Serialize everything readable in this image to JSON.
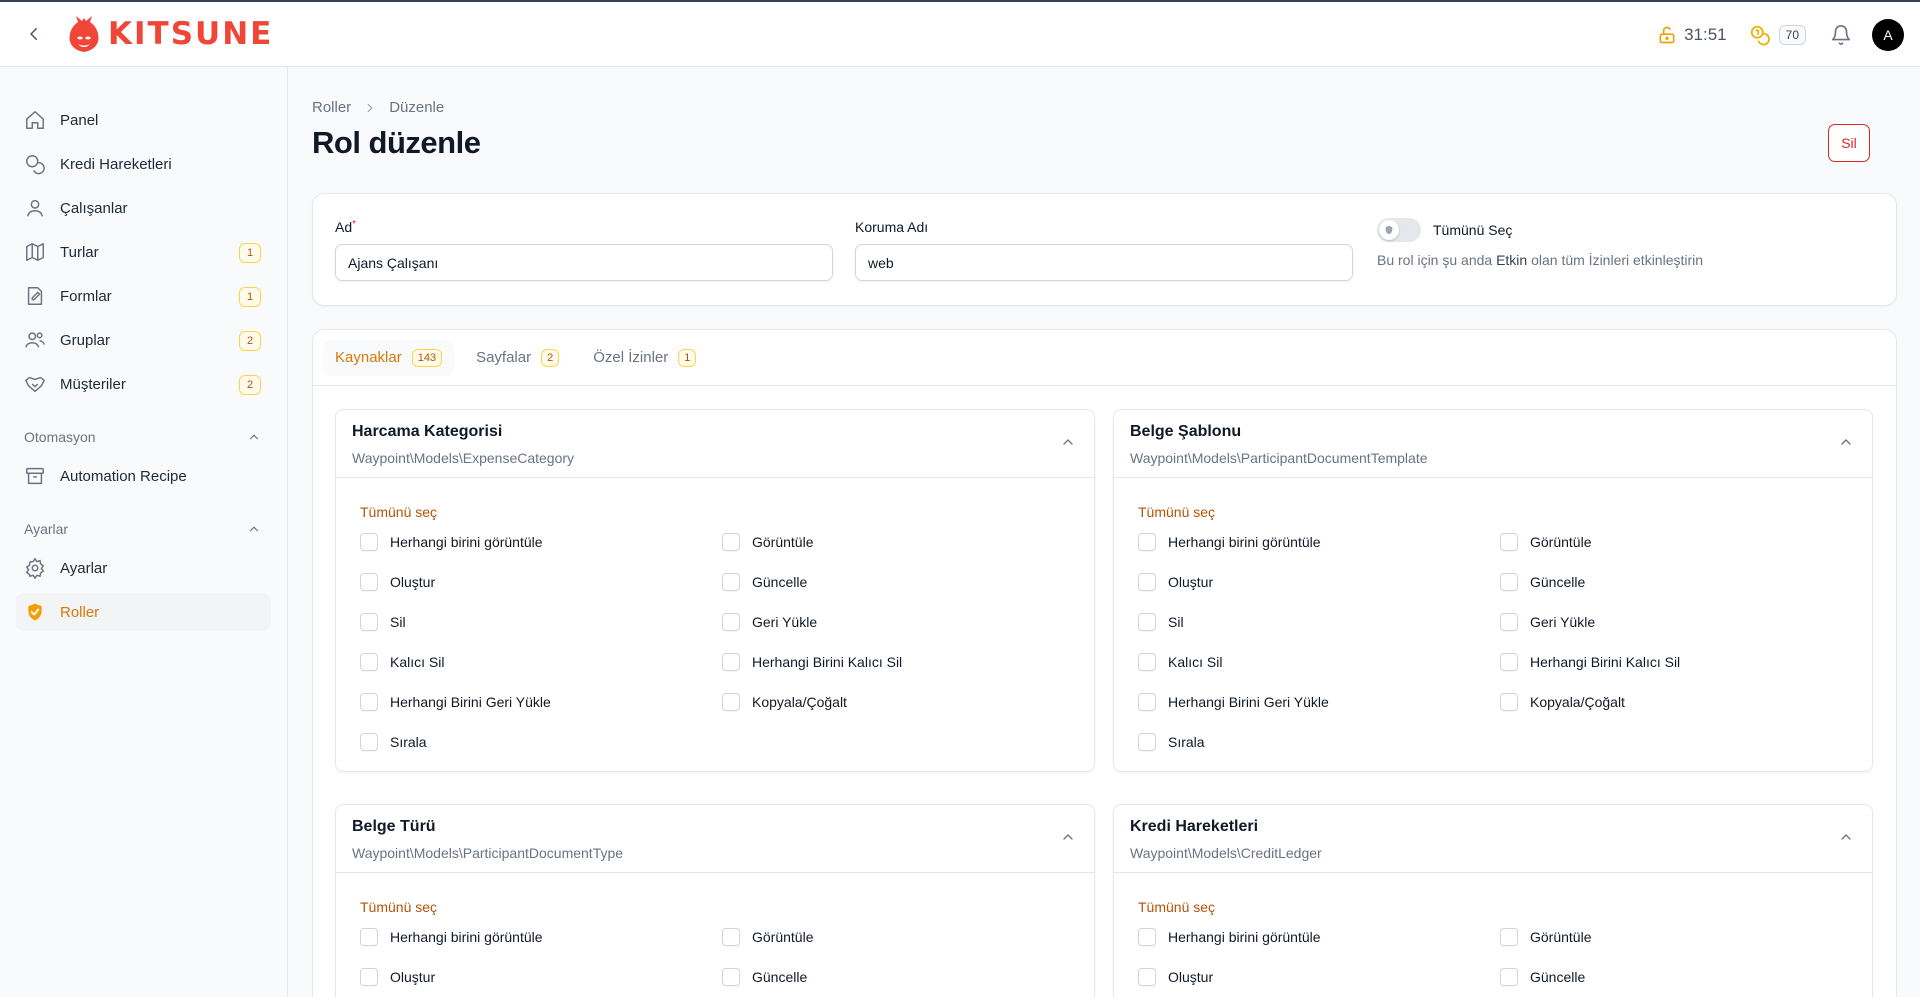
{
  "brand": {
    "name": "KITSUNE",
    "color": "#ef4637"
  },
  "topbar": {
    "timer": "31:51",
    "credits": "70",
    "avatar_initial": "A"
  },
  "sidebar": {
    "items": [
      {
        "label": "Panel",
        "icon": "home-icon"
      },
      {
        "label": "Kredi Hareketleri",
        "icon": "coins-icon"
      },
      {
        "label": "Çalışanlar",
        "icon": "user-icon"
      },
      {
        "label": "Turlar",
        "icon": "map-icon",
        "badge": "1"
      },
      {
        "label": "Formlar",
        "icon": "form-icon",
        "badge": "1"
      },
      {
        "label": "Gruplar",
        "icon": "users-icon",
        "badge": "2"
      },
      {
        "label": "Müşteriler",
        "icon": "handshake-icon",
        "badge": "2"
      }
    ],
    "groups": [
      {
        "label": "Otomasyon",
        "items": [
          {
            "label": "Automation Recipe",
            "icon": "archive-icon"
          }
        ]
      },
      {
        "label": "Ayarlar",
        "items": [
          {
            "label": "Ayarlar",
            "icon": "gear-icon"
          },
          {
            "label": "Roller",
            "icon": "shield-check-icon",
            "active": true
          }
        ]
      }
    ]
  },
  "breadcrumb": {
    "parent": "Roller",
    "current": "Düzenle"
  },
  "page": {
    "title": "Rol düzenle",
    "delete_label": "Sil"
  },
  "form": {
    "name_label": "Ad",
    "name_required": "*",
    "name_value": "Ajans Çalışanı",
    "guard_label": "Koruma Adı",
    "guard_value": "web",
    "select_all_label": "Tümünü Seç",
    "select_all_help_before": "Bu rol için şu anda ",
    "select_all_help_emph": "Etkin",
    "select_all_help_after": " olan tüm İzinleri etkinleştirin"
  },
  "tabs": [
    {
      "label": "Kaynaklar",
      "count": "143",
      "active": true
    },
    {
      "label": "Sayfalar",
      "count": "2"
    },
    {
      "label": "Özel İzinler",
      "count": "1"
    }
  ],
  "select_all_link": "Tümünü seç",
  "resources": [
    {
      "title": "Harcama Kategorisi",
      "model": "Waypoint\\Models\\ExpenseCategory",
      "permissions": [
        "Herhangi birini görüntüle",
        "Görüntüle",
        "Oluştur",
        "Güncelle",
        "Sil",
        "Geri Yükle",
        "Kalıcı Sil",
        "Herhangi Birini Kalıcı Sil",
        "Herhangi Birini Geri Yükle",
        "Kopyala/Çoğalt",
        "Sırala"
      ]
    },
    {
      "title": "Belge Şablonu",
      "model": "Waypoint\\Models\\ParticipantDocumentTemplate",
      "permissions": [
        "Herhangi birini görüntüle",
        "Görüntüle",
        "Oluştur",
        "Güncelle",
        "Sil",
        "Geri Yükle",
        "Kalıcı Sil",
        "Herhangi Birini Kalıcı Sil",
        "Herhangi Birini Geri Yükle",
        "Kopyala/Çoğalt",
        "Sırala"
      ]
    },
    {
      "title": "Belge Türü",
      "model": "Waypoint\\Models\\ParticipantDocumentType",
      "permissions": [
        "Herhangi birini görüntüle",
        "Görüntüle",
        "Oluştur",
        "Güncelle"
      ]
    },
    {
      "title": "Kredi Hareketleri",
      "model": "Waypoint\\Models\\CreditLedger",
      "permissions": [
        "Herhangi birini görüntüle",
        "Görüntüle",
        "Oluştur",
        "Güncelle"
      ]
    }
  ]
}
